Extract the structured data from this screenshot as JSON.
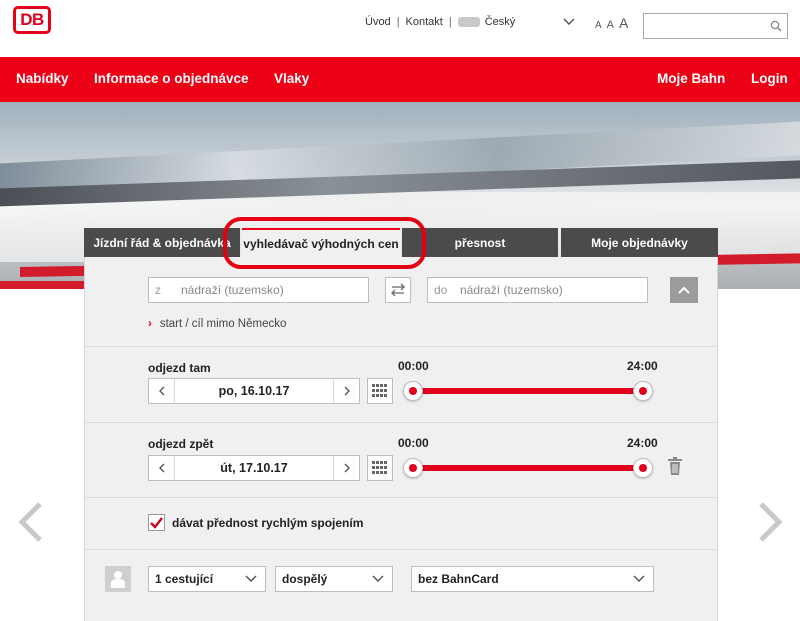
{
  "header": {
    "logo_text": "DB",
    "links": [
      "Úvod",
      "Kontakt"
    ],
    "separator": "|",
    "language": "Český",
    "font_sizes": [
      "A",
      "A",
      "A"
    ],
    "search_placeholder": ""
  },
  "nav": {
    "left": [
      "Nabídky",
      "Informace o objednávce",
      "Vlaky"
    ],
    "right": [
      "Moje Bahn",
      "Login"
    ]
  },
  "tabs": [
    {
      "label": "Jízdní řád & objednávka",
      "active": false
    },
    {
      "label": "vyhledávač výhodných cen",
      "active": true
    },
    {
      "label": "přesnost",
      "active": false
    },
    {
      "label": "Moje objednávky",
      "active": false
    }
  ],
  "form": {
    "from": {
      "prefix": "z",
      "placeholder": "nádraží (tuzemsko)"
    },
    "to": {
      "prefix": "do",
      "placeholder": "nádraží (tuzemsko)"
    },
    "outside_link": "start / cíl mimo Německo",
    "outbound": {
      "label": "odjezd tam",
      "date": "po, 16.10.17",
      "time_from": "00:00",
      "time_to": "24:00"
    },
    "return": {
      "label": "odjezd zpět",
      "date": "út, 17.10.17",
      "time_from": "00:00",
      "time_to": "24:00"
    },
    "fast_connections": {
      "label": "dávat přednost rychlým spojením",
      "checked": true
    },
    "passengers": "1 cestující",
    "age": "dospělý",
    "bahncard": "bez BahnCard"
  },
  "colors": {
    "brand_red": "#ec0016",
    "tab_dark": "#4b4b4b",
    "panel_bg": "#f0f0f0"
  }
}
